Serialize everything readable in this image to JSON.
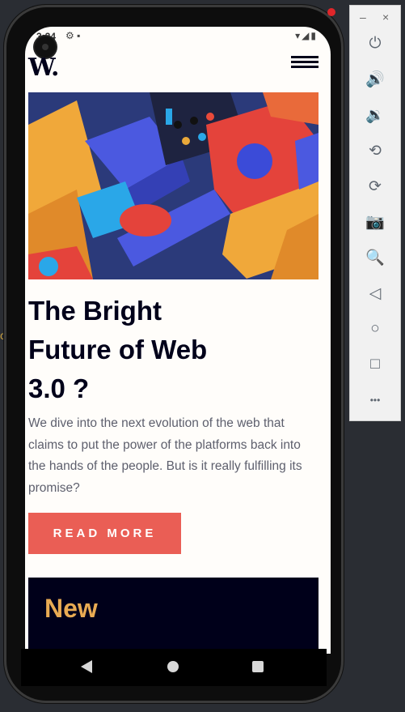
{
  "status_bar": {
    "time": "3:24"
  },
  "app": {
    "logo": "W.",
    "article": {
      "title_lines": [
        "The Bright",
        " Future of Web",
        " 3.0 ?"
      ],
      "description": "We dive into the next evolution of the web that claims to put the power of the platforms back into the hands of the people. But is it really fulfilling its promise?",
      "cta_label": "READ MORE"
    },
    "next_card": {
      "title": "New"
    }
  },
  "emulator_panel": {
    "minimize": "–",
    "close": "×",
    "buttons": [
      {
        "name": "power-icon",
        "glyph": "⏻"
      },
      {
        "name": "volume-up-icon",
        "glyph": "🔊"
      },
      {
        "name": "volume-down-icon",
        "glyph": "🔉"
      },
      {
        "name": "rotate-left-icon",
        "glyph": "⟲"
      },
      {
        "name": "rotate-right-icon",
        "glyph": "⟳"
      },
      {
        "name": "camera-icon",
        "glyph": "📷"
      },
      {
        "name": "zoom-icon",
        "glyph": "🔍"
      },
      {
        "name": "back-icon",
        "glyph": "◁"
      },
      {
        "name": "home-icon",
        "glyph": "○"
      },
      {
        "name": "overview-icon",
        "glyph": "□"
      },
      {
        "name": "more-icon",
        "glyph": "•••"
      }
    ]
  },
  "colors": {
    "accent": "#ea5e55",
    "dark_navy": "#00001a",
    "gold": "#e9ab53",
    "text_gray": "#5d5f6d"
  }
}
